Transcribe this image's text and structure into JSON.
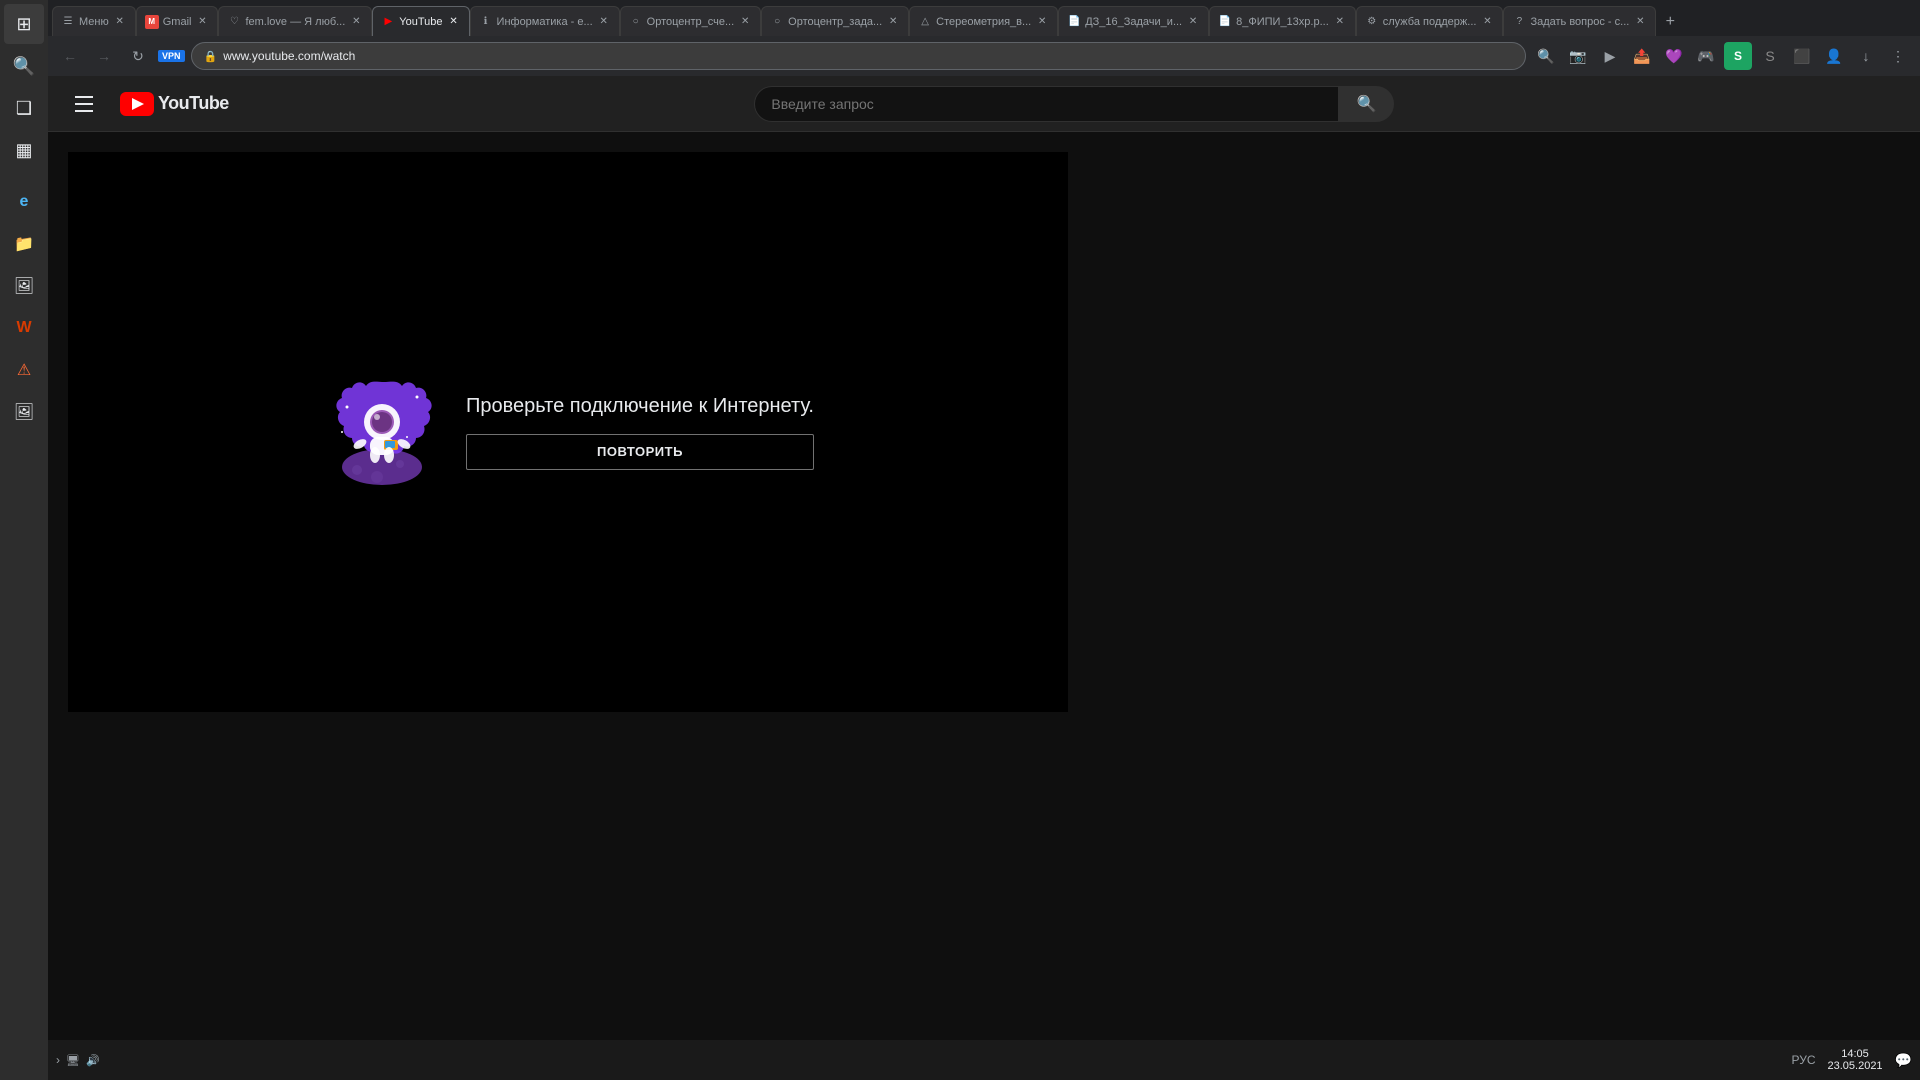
{
  "browser": {
    "tabs": [
      {
        "id": "menu",
        "label": "Меню",
        "favicon": "☰",
        "active": false,
        "closable": true
      },
      {
        "id": "gmail",
        "label": "Gmail",
        "favicon": "M",
        "active": false,
        "closable": true
      },
      {
        "id": "fem",
        "label": "fem.love — Я люб...",
        "favicon": "♡",
        "active": false,
        "closable": true
      },
      {
        "id": "youtube",
        "label": "YouTube",
        "favicon": "▶",
        "active": true,
        "closable": true
      },
      {
        "id": "informatika",
        "label": "Информатика - е...",
        "favicon": "ℹ",
        "active": false,
        "closable": true
      },
      {
        "id": "orto1",
        "label": "Ортоцентр_сче...",
        "favicon": "○",
        "active": false,
        "closable": true
      },
      {
        "id": "orto2",
        "label": "Ортоцентр_зада...",
        "favicon": "○",
        "active": false,
        "closable": true
      },
      {
        "id": "stereo",
        "label": "Стереометрия_в...",
        "favicon": "△",
        "active": false,
        "closable": true
      },
      {
        "id": "dz3",
        "label": "ДЗ_16_Задачи_и...",
        "favicon": "📄",
        "active": false,
        "closable": true
      },
      {
        "id": "fip",
        "label": "8_ФИПИ_13хр.р...",
        "favicon": "📄",
        "active": false,
        "closable": true
      },
      {
        "id": "support",
        "label": "служба поддерж...",
        "favicon": "⚙",
        "active": false,
        "closable": true
      },
      {
        "id": "question",
        "label": "Задать вопрос - с...",
        "favicon": "?",
        "active": false,
        "closable": true
      }
    ],
    "address": "www.youtube.com/watch",
    "vpn_label": "VPN"
  },
  "youtube": {
    "logo_text": "YouTube",
    "search_placeholder": "Введите запрос",
    "header_menu_label": "Меню"
  },
  "error_page": {
    "message": "Проверьте подключение к Интернету.",
    "retry_button_label": "ПОВТОРИТЬ",
    "astronaut_alt": "Astronaut on moon illustration"
  },
  "taskbar": {
    "lang": "РУС",
    "time": "14:05",
    "date": "23.05.2021"
  },
  "sidebar": {
    "icons": [
      {
        "name": "windows-icon",
        "symbol": "⊞"
      },
      {
        "name": "search-icon",
        "symbol": "🔍"
      },
      {
        "name": "task-view-icon",
        "symbol": "❑"
      },
      {
        "name": "widgets-icon",
        "symbol": "▦"
      },
      {
        "name": "edge-icon",
        "symbol": "e"
      },
      {
        "name": "folder-icon",
        "symbol": "📁"
      },
      {
        "name": "photos-icon",
        "symbol": "🖼"
      },
      {
        "name": "office-icon",
        "symbol": "W"
      },
      {
        "name": "alert-icon",
        "symbol": "⚠"
      },
      {
        "name": "image-viewer-icon",
        "symbol": "🖼"
      }
    ]
  },
  "browser_actions": {
    "extensions": [
      "🔍",
      "📷",
      "▶",
      "📤",
      "💜",
      "🎮",
      "S",
      "S",
      "⬛",
      "🔒",
      "↓"
    ]
  }
}
